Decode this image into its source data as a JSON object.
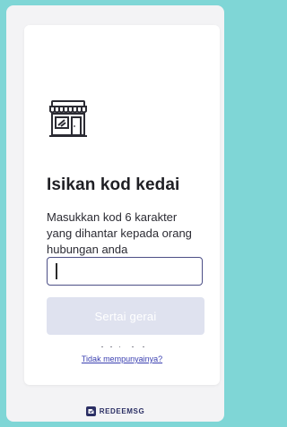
{
  "store_page": {
    "title": "Isikan kod kedai",
    "description": "Masukkan kod 6 karakter yang dihantar kepada orang hubungan anda",
    "code_input": {
      "value": "",
      "placeholder": ""
    },
    "join_button_label": "Sertai gerai",
    "no_code_link": "Tidak mempunyainya?"
  },
  "footer": {
    "brand": "REDEEMSG"
  },
  "icons": {
    "store": "storefront-icon",
    "brand": "redeemsg-logo-icon"
  },
  "colors": {
    "page_background": "#7fd6d6",
    "input_border": "#4c4f86",
    "button_disabled": "#dfe2ef",
    "link": "#3a3fb0",
    "brand_text": "#2b2f64"
  }
}
